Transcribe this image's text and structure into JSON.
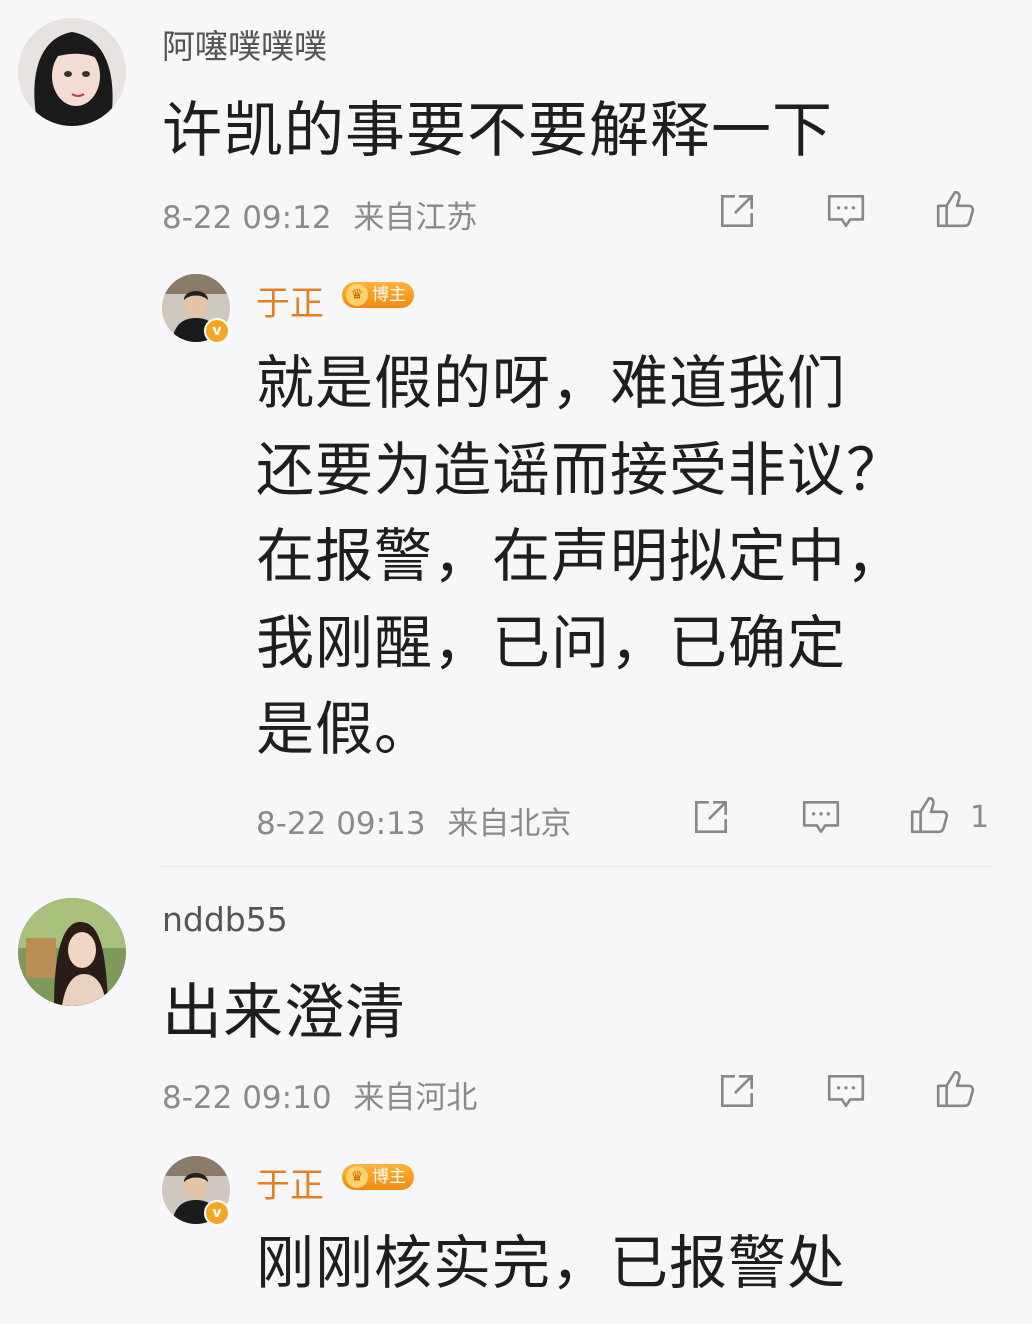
{
  "comments": [
    {
      "username": "阿噻噗噗噗",
      "content": "许凯的事要不要解释一下",
      "time": "8-22 09:12",
      "location": "来自江苏",
      "reply": {
        "username": "于正",
        "badge": "博主",
        "content_lines": [
          "就是假的呀，难道我们",
          "还要为造谣而接受非议？",
          "在报警，在声明拟定中，",
          "我刚醒，已问，已确定",
          "是假。"
        ],
        "time": "8-22 09:13",
        "location": "来自北京",
        "likes": "1"
      }
    },
    {
      "username": "nddb55",
      "content": "出来澄清",
      "time": "8-22 09:10",
      "location": "来自河北",
      "reply": {
        "username": "于正",
        "badge": "博主",
        "content_lines": [
          "刚刚核实完，已报警处"
        ]
      }
    }
  ],
  "icons": {
    "share": "share-icon",
    "comment": "comment-icon",
    "like": "thumbs-up-icon",
    "verified": "verified-icon"
  },
  "colors": {
    "reply_username": "#e67e22",
    "badge": "#f5a623",
    "meta_text": "#8a8a8a"
  }
}
